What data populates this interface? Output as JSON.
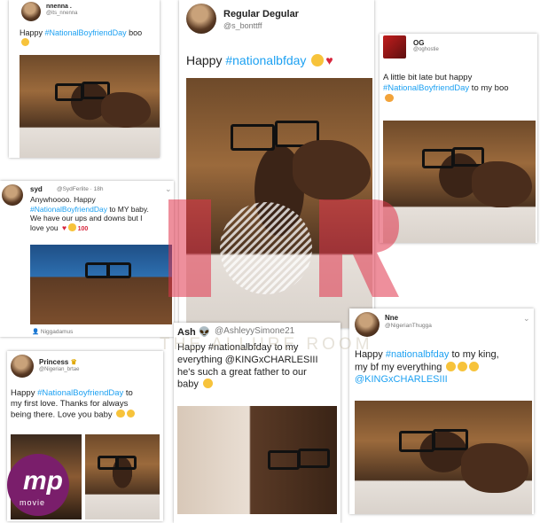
{
  "posts": [
    {
      "name": "nnenna .",
      "handle": "@its_nnenna",
      "text_plain_before": "Happy ",
      "tag": "#NationalBoyfriendDay",
      "text_plain_after": " boo",
      "icons": [
        "face-emoji"
      ]
    },
    {
      "name": "Regular Degular",
      "handle": "@s_bonttff",
      "text_plain_before": "Happy ",
      "tag": "#nationalbfday",
      "text_plain_after": "",
      "icons": [
        "kiss-emoji",
        "heart-emoji"
      ]
    },
    {
      "name": "OG",
      "handle": "@oghostie",
      "line1": "A little bit late but happy",
      "tag": "#NationalBoyfriendDay",
      "text_plain_after": " to my boo",
      "icons": [
        "heart-eyes-emoji"
      ]
    },
    {
      "name": "syd",
      "handle": "@SydFerlite",
      "time": "18h",
      "line1": "Anywhoooo. Happy",
      "tag": "#NationalBoyfriendDay",
      "text_plain_after": " to MY baby.",
      "line3": "We have our ups and downs but I",
      "line4": "love you",
      "icons": [
        "heart-emoji",
        "kiss-emoji",
        "hundred-emoji"
      ],
      "media_label": "Niggadamus"
    },
    {
      "name": "Ash",
      "handle": "@AshleyySimone21",
      "line1": "Happy #nationalbfday to my",
      "line2": "everything @KINGxCHARLESIII",
      "line3": "he's such a great father to our",
      "line4": "baby",
      "icons": [
        "joy-emoji"
      ]
    },
    {
      "name": "Nne",
      "handle": "@NigerianThugga",
      "text_plain_before": "Happy ",
      "tag": "#nationalbfday",
      "text_plain_after": " to my king,",
      "line2": "my bf my everything",
      "mention": "@KINGxCHARLESIII",
      "icons": [
        "kiss-emoji",
        "kiss-emoji",
        "kiss-emoji"
      ]
    },
    {
      "name": "Princess",
      "handle": "@Nigerian_brtae",
      "text_plain_before": "Happy ",
      "tag": "#NationalBoyfriendDay",
      "text_plain_after": " to",
      "line2": "my first love. Thanks for always",
      "line3": "being there. Love you baby",
      "icons": [
        "kiss-emoji",
        "kiss-emoji"
      ]
    }
  ],
  "watermark": {
    "text": "THE ALLURE ROOM",
    "color": "#e0334a"
  },
  "logo": {
    "letter": "mp",
    "sub": "movie"
  }
}
